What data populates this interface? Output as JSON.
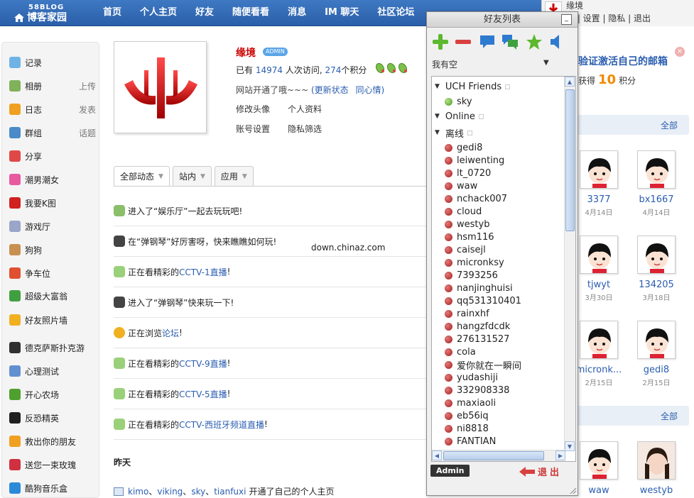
{
  "site": {
    "logo_small": "58BLOG",
    "logo_big": "博客家园"
  },
  "nav": [
    "首页",
    "个人主页",
    "好友",
    "随便看看",
    "消息",
    "IM 聊天",
    "社区论坛"
  ],
  "userbar": {
    "username": "缘境",
    "links_text": "置 | 设置 | 隐私 | 退出"
  },
  "sidebar": {
    "items": [
      {
        "label": "记录",
        "extra": "",
        "icon": "speech-bubble-icon",
        "color": "#6fb3e6"
      },
      {
        "label": "相册",
        "extra": "上传",
        "icon": "photo-icon",
        "color": "#7fb25a"
      },
      {
        "label": "日志",
        "extra": "发表",
        "icon": "notebook-icon",
        "color": "#f0a020"
      },
      {
        "label": "群组",
        "extra": "话题",
        "icon": "group-icon",
        "color": "#4a8ac8"
      },
      {
        "label": "分享",
        "extra": "",
        "icon": "heart-icon",
        "color": "#e04848"
      },
      {
        "label": "潮男潮女",
        "extra": "",
        "icon": "gift-icon",
        "color": "#e85aa0"
      },
      {
        "label": "我要K图",
        "extra": "",
        "icon": "k-icon",
        "color": "#d02020"
      },
      {
        "label": "游戏厅",
        "extra": "",
        "icon": "gamepad-icon",
        "color": "#9aa6c8"
      },
      {
        "label": "狗狗",
        "extra": "",
        "icon": "dog-icon",
        "color": "#c89050"
      },
      {
        "label": "争车位",
        "extra": "",
        "icon": "parking-icon",
        "color": "#e05030"
      },
      {
        "label": "超级大富翁",
        "extra": "",
        "icon": "dice-icon",
        "color": "#40a040"
      },
      {
        "label": "好友照片墙",
        "extra": "",
        "icon": "smiley-icon",
        "color": "#f0b020"
      },
      {
        "label": "德克萨斯扑克游",
        "extra": "",
        "icon": "poker-chip-icon",
        "color": "#303030"
      },
      {
        "label": "心理测试",
        "extra": "",
        "icon": "flask-icon",
        "color": "#6090d0"
      },
      {
        "label": "开心农场",
        "extra": "",
        "icon": "sprout-icon",
        "color": "#50a030"
      },
      {
        "label": "反恐精英",
        "extra": "",
        "icon": "cs-icon",
        "color": "#202020"
      },
      {
        "label": "救出你的朋友",
        "extra": "",
        "icon": "blocks-icon",
        "color": "#f0a020"
      },
      {
        "label": "送您一束玫瑰",
        "extra": "",
        "icon": "rose-icon",
        "color": "#d03040"
      },
      {
        "label": "酷狗音乐盒",
        "extra": "",
        "icon": "music-icon",
        "color": "#2a8ad8"
      }
    ]
  },
  "profile": {
    "name": "缘境",
    "badge": "ADMIN",
    "visits_prefix": "已有",
    "visits": "14974",
    "visits_mid": "人次访问,",
    "points": "274",
    "points_suffix": "个积分",
    "status": "网站开通了哦~~~",
    "update_status": "(更新状态",
    "mood": "同心情)",
    "links": [
      "修改头像",
      "个人资料",
      "账号设置",
      "隐私筛选"
    ]
  },
  "tabs": [
    "全部动态",
    "站内",
    "应用"
  ],
  "feed": [
    {
      "icon": "leaf-icon",
      "parts": [
        "进入了“",
        "娱乐厅",
        "”一起去玩玩吧!"
      ],
      "link_color": "#222"
    },
    {
      "icon": "piano-icon",
      "parts": [
        "在“",
        "弹钢琴",
        "”好厉害呀，快来瞧瞧如何玩!"
      ],
      "link_color": "#222"
    },
    {
      "icon": "tv-chat-icon",
      "parts": [
        "正在看精彩的",
        "CCTV-1直播",
        "!"
      ],
      "link_color": "#2a5db0"
    },
    {
      "icon": "piano-icon",
      "parts": [
        "进入了“",
        "弹钢琴",
        "”快来玩一下!"
      ],
      "link_color": "#222"
    },
    {
      "icon": "smiley-icon",
      "parts": [
        "正在浏览",
        "论坛",
        "!"
      ],
      "link_color": "#2a5db0"
    },
    {
      "icon": "tv-chat-icon",
      "parts": [
        "正在看精彩的",
        "CCTV-9直播",
        "!"
      ],
      "link_color": "#2a5db0"
    },
    {
      "icon": "tv-chat-icon",
      "parts": [
        "正在看精彩的",
        "CCTV-5直播",
        "!"
      ],
      "link_color": "#2a5db0"
    },
    {
      "icon": "tv-chat-icon",
      "parts": [
        "正在看精彩的",
        "CCTV-西班牙频道直播",
        "!"
      ],
      "link_color": "#2a5db0"
    }
  ],
  "watermark": "down.chinaz.com",
  "yesterday": "昨天",
  "last_feed": {
    "names": [
      "kimo",
      "viking",
      "sky",
      "tianfuxi"
    ],
    "sep": "、",
    "text": "开通了自己的个人主页"
  },
  "notice": {
    "title": "验证激活自己的邮箱",
    "prefix": "获得",
    "points": "10",
    "suffix": "积分"
  },
  "right_sections": [
    {
      "all": "全部"
    },
    {
      "all": "全部"
    }
  ],
  "friends_recent": [
    {
      "name": "3377",
      "date": "4月14日"
    },
    {
      "name": "bx1667",
      "date": "4月14日"
    },
    {
      "name": "tjwyt",
      "date": "3月30日"
    },
    {
      "name": "134205",
      "date": "3月18日"
    },
    {
      "name": "micronk...",
      "date": "2月15日"
    },
    {
      "name": "gedi8",
      "date": "2月15日"
    },
    {
      "name": "waw",
      "date": ""
    },
    {
      "name": "westyb",
      "date": ""
    }
  ],
  "buddy": {
    "title": "好友列表",
    "min_label": "_",
    "status": "我有空",
    "groups": [
      {
        "name": "UCH Friends",
        "members": [
          {
            "name": "sky",
            "online": true
          }
        ]
      },
      {
        "name": "Online",
        "members": []
      },
      {
        "name": "离线",
        "members": [
          {
            "name": "gedi8"
          },
          {
            "name": "leiwenting"
          },
          {
            "name": "lt_0720"
          },
          {
            "name": "waw"
          },
          {
            "name": "nchack007"
          },
          {
            "name": "cloud"
          },
          {
            "name": "westyb"
          },
          {
            "name": "hsm116"
          },
          {
            "name": "caisejl"
          },
          {
            "name": "micronksy"
          },
          {
            "name": "7393256"
          },
          {
            "name": "nanjinghuisi"
          },
          {
            "name": "qq531310401"
          },
          {
            "name": "rainxhf"
          },
          {
            "name": "hangzfdcdk"
          },
          {
            "name": "276131527"
          },
          {
            "name": "cola"
          },
          {
            "name": "爱你就在一瞬间"
          },
          {
            "name": "yudashiji"
          },
          {
            "name": "332908338"
          },
          {
            "name": "maxiaoli"
          },
          {
            "name": "eb56iq"
          },
          {
            "name": "ni8818"
          },
          {
            "name": "FANTIAN"
          }
        ]
      }
    ],
    "admin_label": "Admin",
    "logout_label": "退出"
  }
}
